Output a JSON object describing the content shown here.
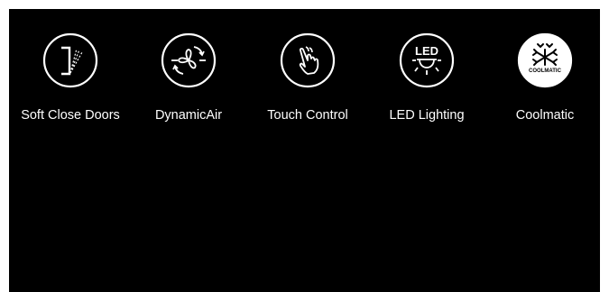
{
  "features": [
    {
      "label": "Soft Close Doors",
      "icon": "soft-close-door-icon"
    },
    {
      "label": "DynamicAir",
      "icon": "dynamic-air-fan-icon"
    },
    {
      "label": "Touch Control",
      "icon": "touch-hand-icon"
    },
    {
      "label": "LED Lighting",
      "icon": "led-light-icon",
      "icon_text": "LED"
    },
    {
      "label": "Coolmatic",
      "icon": "coolmatic-snowflake-icon",
      "icon_text": "COOLMATIC"
    }
  ],
  "colors": {
    "background": "#000000",
    "foreground": "#ffffff"
  }
}
